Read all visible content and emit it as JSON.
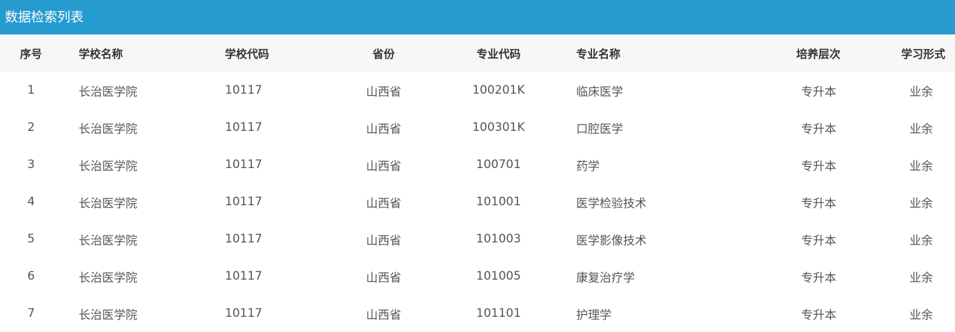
{
  "panel": {
    "title": "数据检索列表"
  },
  "columns": [
    "序号",
    "学校名称",
    "学校代码",
    "省份",
    "专业代码",
    "专业名称",
    "培养层次",
    "学习形式"
  ],
  "rows": [
    [
      "1",
      "长治医学院",
      "10117",
      "山西省",
      "100201K",
      "临床医学",
      "专升本",
      "业余"
    ],
    [
      "2",
      "长治医学院",
      "10117",
      "山西省",
      "100301K",
      "口腔医学",
      "专升本",
      "业余"
    ],
    [
      "3",
      "长治医学院",
      "10117",
      "山西省",
      "100701",
      "药学",
      "专升本",
      "业余"
    ],
    [
      "4",
      "长治医学院",
      "10117",
      "山西省",
      "101001",
      "医学检验技术",
      "专升本",
      "业余"
    ],
    [
      "5",
      "长治医学院",
      "10117",
      "山西省",
      "101003",
      "医学影像技术",
      "专升本",
      "业余"
    ],
    [
      "6",
      "长治医学院",
      "10117",
      "山西省",
      "101005",
      "康复治疗学",
      "专升本",
      "业余"
    ],
    [
      "7",
      "长治医学院",
      "10117",
      "山西省",
      "101101",
      "护理学",
      "专升本",
      "业余"
    ]
  ]
}
